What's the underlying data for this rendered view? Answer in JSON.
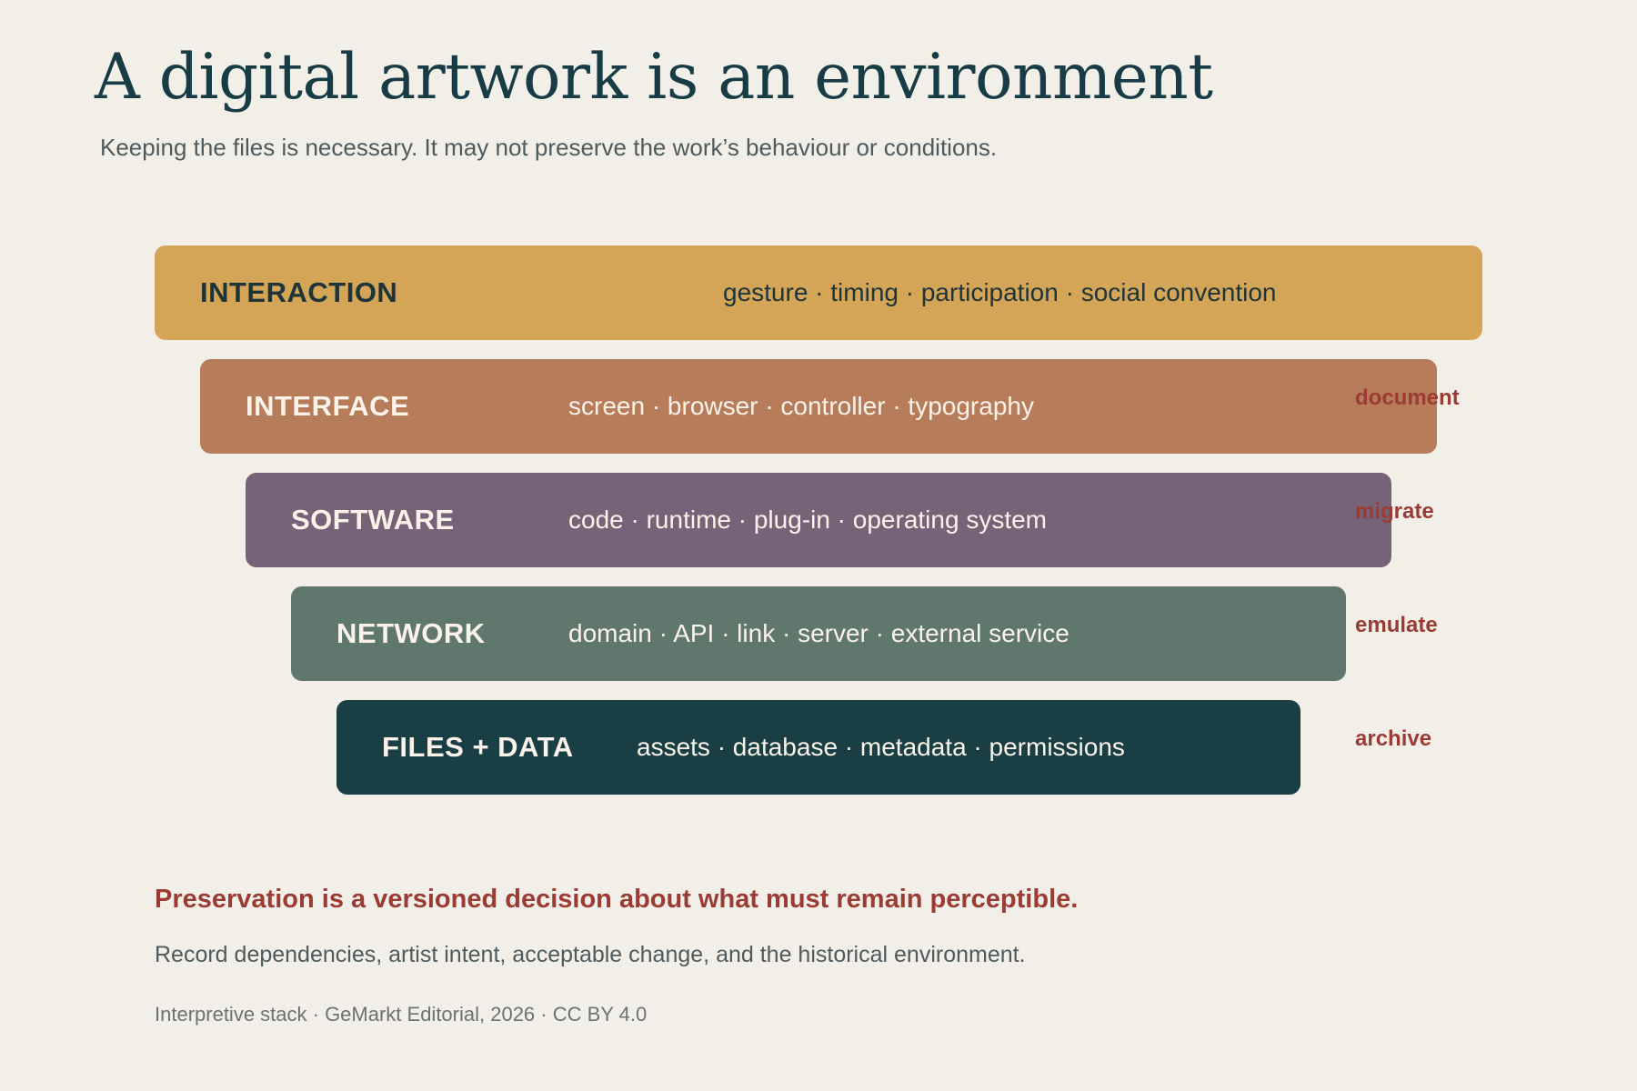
{
  "title": "A digital artwork is an environment",
  "subtitle": "Keeping the files is necessary. It may not preserve the work’s behaviour or conditions.",
  "layers": [
    {
      "name": "INTERACTION",
      "items": "gesture · timing · participation · social convention",
      "color": "#d4a556",
      "text_color": "#1f3438",
      "strategy": ""
    },
    {
      "name": "INTERFACE",
      "items": "screen · browser · controller · typography",
      "color": "#b77c5a",
      "text_color": "#fbf3ea",
      "strategy": "document"
    },
    {
      "name": "SOFTWARE",
      "items": "code · runtime · plug-in · operating system",
      "color": "#766377",
      "text_color": "#fbf3ea",
      "strategy": "migrate"
    },
    {
      "name": "NETWORK",
      "items": "domain · API · link · server · external service",
      "color": "#5f776c",
      "text_color": "#fbf3ea",
      "strategy": "emulate"
    },
    {
      "name": "FILES + DATA",
      "items": "assets · database · metadata · permissions",
      "color": "#193f44",
      "text_color": "#fbf3ea",
      "strategy": "archive"
    }
  ],
  "strategy_color": "#9a3c33",
  "conclusion": "Preservation is a versioned decision about what must remain perceptible.",
  "note": "Record dependencies, artist intent, acceptable change, and the historical environment.",
  "credit": "Interpretive stack · GeMarkt Editorial, 2026 · CC BY 4.0"
}
